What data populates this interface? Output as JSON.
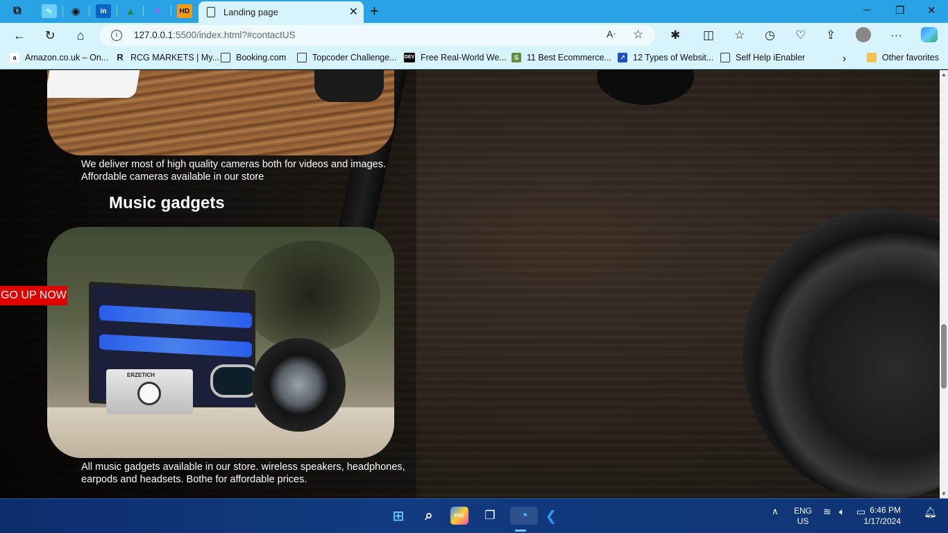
{
  "browser": {
    "active_tab_title": "Landing page",
    "url_host": "127.0.0.1",
    "url_rest": ":5500/index.html?#contactUS",
    "pinned_tabs": [
      "copilot-icon",
      "paint-icon",
      "github-icon",
      "linkedin-icon",
      "drive-icon",
      "figma-icon",
      "hd-icon"
    ],
    "favorites": [
      {
        "label": "Amazon.co.uk – On...",
        "icon": "amazon-icon"
      },
      {
        "label": "RCG MARKETS | My...",
        "icon": "rcg-icon"
      },
      {
        "label": "Booking.com",
        "icon": "page-icon"
      },
      {
        "label": "Topcoder Challenge...",
        "icon": "page-icon"
      },
      {
        "label": "Free Real-World We...",
        "icon": "dev-icon"
      },
      {
        "label": "11 Best Ecommerce...",
        "icon": "shopify-icon"
      },
      {
        "label": "12 Types of Websit...",
        "icon": "chart-icon"
      },
      {
        "label": "Self Help iEnabler",
        "icon": "page-icon"
      }
    ],
    "other_favorites": "Other favorites"
  },
  "page": {
    "camera_caption_line1": "We deliver most of high quality cameras both for videos and images.",
    "camera_caption_line2": "Affordable cameras available in our store",
    "music_title": "Music gadgets",
    "music_caption_line1": "All music gadgets available in our store. wireless speakers, headphones,",
    "music_caption_line2": "earpods and headsets. Bothe for affordable prices.",
    "go_up_button": "GO UP NOW",
    "amp_brand": "ERZETICH"
  },
  "taskbar": {
    "language_line1": "ENG",
    "language_line2": "US",
    "time": "6:46 PM",
    "date": "1/17/2024"
  },
  "colors": {
    "tab_strip": "#2aa3e6",
    "toolbar": "#d7f3fb",
    "go_up_bg": "#e00000",
    "taskbar": "#123a80"
  }
}
